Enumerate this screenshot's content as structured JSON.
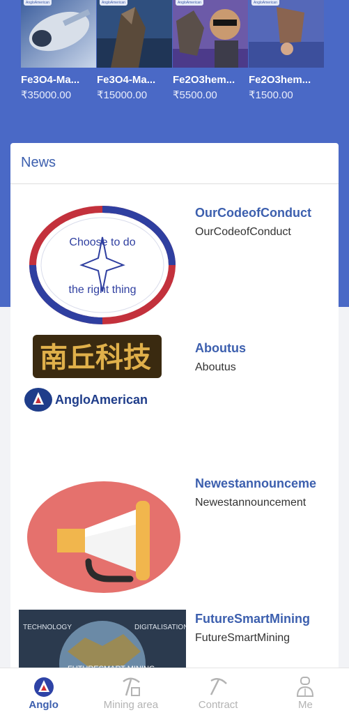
{
  "products": [
    {
      "name": "Fe3O4-Ma...",
      "price": "₹35000.00",
      "tag": "AngloAmerican"
    },
    {
      "name": "Fe3O4-Ma...",
      "price": "₹15000.00",
      "tag": "AngloAmerican"
    },
    {
      "name": "Fe2O3hem...",
      "price": "₹5500.00",
      "tag": "AngloAmerican"
    },
    {
      "name": "Fe2O3hem...",
      "price": "₹1500.00",
      "tag": "AngloAmerican"
    }
  ],
  "news": {
    "title": "News",
    "items": [
      {
        "title": "OurCodeofConduct",
        "desc": "OurCodeofConduct",
        "img_text": [
          "Choose to do",
          "the right thing"
        ]
      },
      {
        "title": "Aboutus",
        "desc": "Aboutus",
        "img_text": [
          "南丘科技",
          "AngloAmerican"
        ]
      },
      {
        "title": "Newestannounceme",
        "desc": "Newestannouncement"
      },
      {
        "title": "FutureSmartMining",
        "desc": "FutureSmartMining",
        "img_text": [
          "TECHNOLOGY",
          "DIGITALISATION",
          "FUTURESMART MINING"
        ]
      }
    ]
  },
  "tabbar": {
    "tabs": [
      {
        "label": "Anglo",
        "active": true
      },
      {
        "label": "Mining area",
        "active": false
      },
      {
        "label": "Contract",
        "active": false
      },
      {
        "label": "Me",
        "active": false
      }
    ]
  },
  "colors": {
    "brand_blue": "#4a69c6",
    "link_blue": "#3c5fae",
    "inactive": "#b3b3b3"
  }
}
